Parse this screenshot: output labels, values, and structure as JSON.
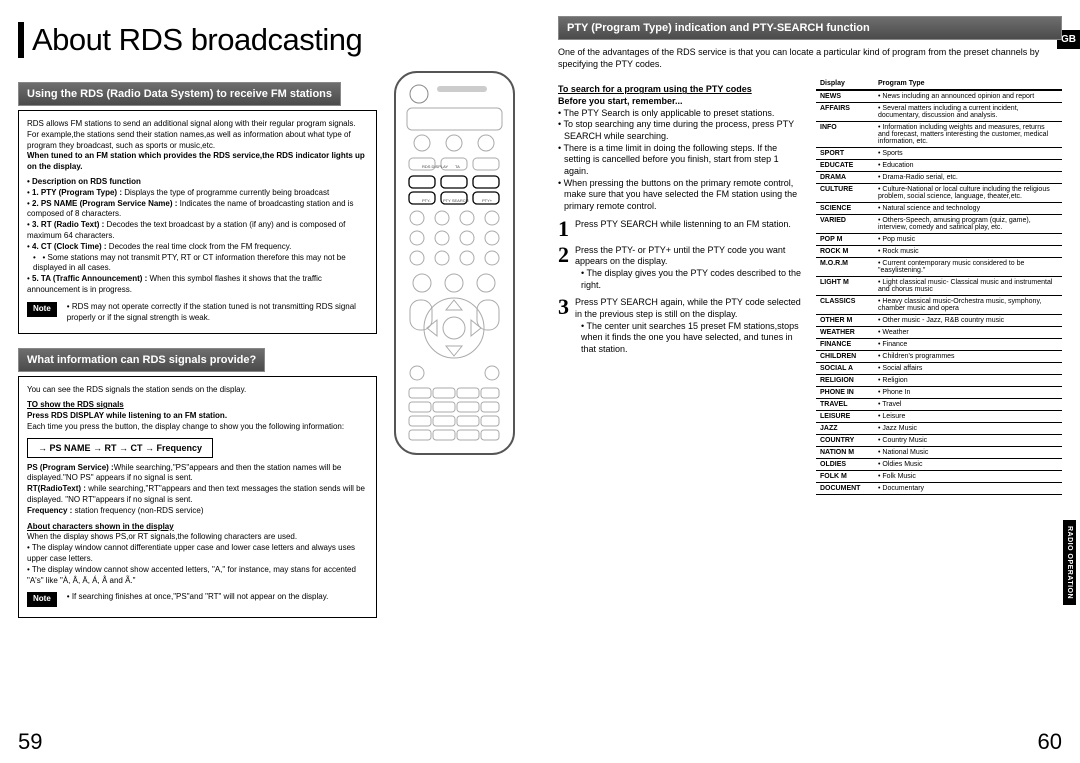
{
  "gb": "GB",
  "sideTab": "RADIO OPERATION",
  "title": "About RDS broadcasting",
  "leftPageNum": "59",
  "rightPageNum": "60",
  "sec1": {
    "bar": "Using the RDS (Radio Data System) to receive FM stations",
    "intro": "RDS allows FM stations to send an additional signal along with their regular program signals. For example,the stations send their station names,as well as information about what type of program they broadcast, such as sports or music,etc.",
    "boldLine": "When tuned to an FM station which provides the RDS service,the RDS indicator lights up on the display.",
    "descHead": "Description on RDS function",
    "items": [
      {
        "t": "1. PTY (Program Type) :",
        "d": " Displays the type of programme currently being broadcast"
      },
      {
        "t": "2. PS NAME (Program Service Name) :",
        "d": " Indicates the name of broadcasting station and is composed of 8 characters."
      },
      {
        "t": "3. RT (Radio Text) :",
        "d": " Decodes the text broadcast by a station (if any) and is composed of maximum 64 characters."
      },
      {
        "t": "4. CT (Clock Time) :",
        "d": " Decodes the real time clock from the FM frequency."
      },
      {
        "t": "",
        "d": "Some stations may not transmit PTY, RT or CT information therefore this may not be displayed in all cases.",
        "bullet": true
      },
      {
        "t": "5. TA (Traffic Announcement) :",
        "d": " When this symbol flashes it shows that the traffic announcement is in progress."
      }
    ],
    "noteLabel": "Note",
    "note": "RDS may not operate correctly if the station tuned is not transmitting RDS signal properly or if the signal strength is weak."
  },
  "sec2": {
    "bar": "What information can RDS signals provide?",
    "line1": "You can see the RDS signals the station sends on the display.",
    "h1": "TO show the RDS signals",
    "h2": "Press RDS DISPLAY while listening to an FM station.",
    "line2": "Each time you press the button, the display change to show you the following information:",
    "flow": "→ PS NAME → RT → CT → Frequency",
    "psLabel": "PS (Program Service) :",
    "psText": "While searching,\"PS\"appears and then the station names will be displayed.\"NO PS\" appears if no signal is sent.",
    "rtLabel": "RT(RadioText) :",
    "rtText": " while searching,\"RT\"appears and then text messages the station sends will be displayed. \"NO RT\"appears if no signal is sent.",
    "freqLabel": "Frequency :",
    "freqText": " station frequency (non-RDS service)",
    "h3": "About characters shown in the display",
    "line3": "When the display shows PS,or RT signals,the following characters are used.",
    "b1": "The display window cannot differentiate upper case and lower case letters and always uses upper case letters.",
    "b2": "The display window cannot show accented letters, \"A,\" for instance, may stans for accented \"A's\" like \"À, Â, Ä, Á, Å and Ã.\"",
    "noteLabel": "Note",
    "note": "If searching finishes at once,\"PS\"and \"RT\" will not appear on the display."
  },
  "sec3": {
    "bar": "PTY (Program Type) indication and PTY-SEARCH function",
    "intro": "One of the advantages of the RDS service is that you can locate a particular kind of program from the preset channels by specifying the PTY codes.",
    "h1": "To search for a program using the PTY codes",
    "h2": "Before you start, remember...",
    "bullets": [
      "The PTY Search is only applicable to preset stations.",
      "To stop searching any time during the process, press PTY SEARCH while searching.",
      "There is a time limit in doing the following steps. If the setting is cancelled before you finish, start from step 1 again.",
      "When pressing the buttons on the primary remote control, make sure that you have selected the FM station using the primary remote control."
    ],
    "steps": [
      {
        "n": "1",
        "t": "Press PTY SEARCH while listenning to an FM station."
      },
      {
        "n": "2",
        "t": "Press the PTY- or PTY+ until the PTY code you want appears on the display.",
        "sub": [
          "The display gives you the PTY codes described to the right."
        ]
      },
      {
        "n": "3",
        "t": "Press PTY SEARCH again, while the PTY code selected in the previous step is still on the display.",
        "sub": [
          "The center unit searches 15 preset FM stations,stops when it finds the one you have selected, and tunes in that station."
        ]
      }
    ],
    "tableHead": {
      "c1": "Display",
      "c2": "Program Type"
    },
    "table": [
      {
        "d": "NEWS",
        "p": "News including an announced opinion and report"
      },
      {
        "d": "AFFAIRS",
        "p": "Several matters including a current incident, documentary, discussion and analysis."
      },
      {
        "d": "INFO",
        "p": "Information including weights and measures, returns and forecast, matters interesting the customer, medical information, etc."
      },
      {
        "d": "SPORT",
        "p": "Sports"
      },
      {
        "d": "EDUCATE",
        "p": "Education"
      },
      {
        "d": "DRAMA",
        "p": "Drama-Radio serial, etc."
      },
      {
        "d": "CULTURE",
        "p": "Culture-National or local culture including the religious problem, social science, language, theater,etc."
      },
      {
        "d": "SCIENCE",
        "p": "Natural science and technology"
      },
      {
        "d": "VARIED",
        "p": "Others-Speech, amusing program (quiz, game), interview, comedy and satirical play, etc."
      },
      {
        "d": "POP M",
        "p": "Pop music"
      },
      {
        "d": "ROCK M",
        "p": "Rock music"
      },
      {
        "d": "M.O.R.M",
        "p": "Current contemporary music considered to be \"easylistening.\""
      },
      {
        "d": "LIGHT M",
        "p": "Light classical music- Classical music and instrumental and chorus music"
      },
      {
        "d": "CLASSICS",
        "p": "Heavy classical music-Orchestra music, symphony, chamber music and opera"
      },
      {
        "d": "OTHER M",
        "p": "Other music - Jazz, R&B country music"
      },
      {
        "d": "WEATHER",
        "p": "Weather"
      },
      {
        "d": "FINANCE",
        "p": "Finance"
      },
      {
        "d": "CHILDREN",
        "p": "Children's programmes"
      },
      {
        "d": "SOCIAL A",
        "p": "Social affairs"
      },
      {
        "d": "RELIGION",
        "p": "Religion"
      },
      {
        "d": "PHONE IN",
        "p": "Phone In"
      },
      {
        "d": "TRAVEL",
        "p": "Travel"
      },
      {
        "d": "LEISURE",
        "p": "Leisure"
      },
      {
        "d": "JAZZ",
        "p": "Jazz Music"
      },
      {
        "d": "COUNTRY",
        "p": "Country Music"
      },
      {
        "d": "NATION M",
        "p": "National Music"
      },
      {
        "d": "OLDIES",
        "p": "Oldies Music"
      },
      {
        "d": "FOLK M",
        "p": "Folk Music"
      },
      {
        "d": "DOCUMENT",
        "p": "Documentary"
      }
    ]
  }
}
